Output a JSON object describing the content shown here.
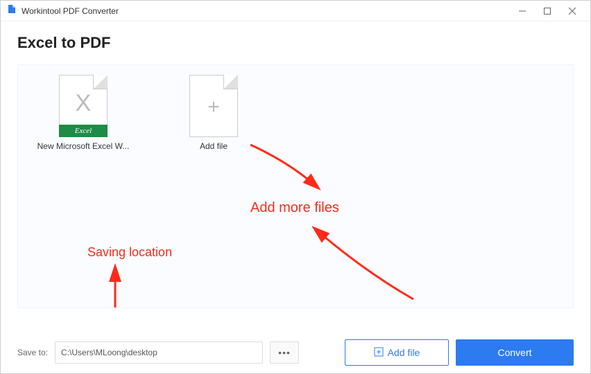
{
  "app": {
    "title": "Workintool PDF Converter"
  },
  "page": {
    "heading": "Excel to PDF"
  },
  "files": {
    "item": {
      "name": "New Microsoft Excel W...",
      "badge": "Excel"
    },
    "add_tile_label": "Add file"
  },
  "footer": {
    "save_to_label": "Save to:",
    "path": "C:\\Users\\MLoong\\desktop",
    "browse_label": "•••",
    "addfile_label": "Add file",
    "convert_label": "Convert"
  },
  "annotations": {
    "add_more": "Add more files",
    "saving_location": "Saving location"
  },
  "colors": {
    "accent": "#2d7bf0",
    "annotation": "#ff2a1a",
    "excel": "#1d8c46"
  }
}
